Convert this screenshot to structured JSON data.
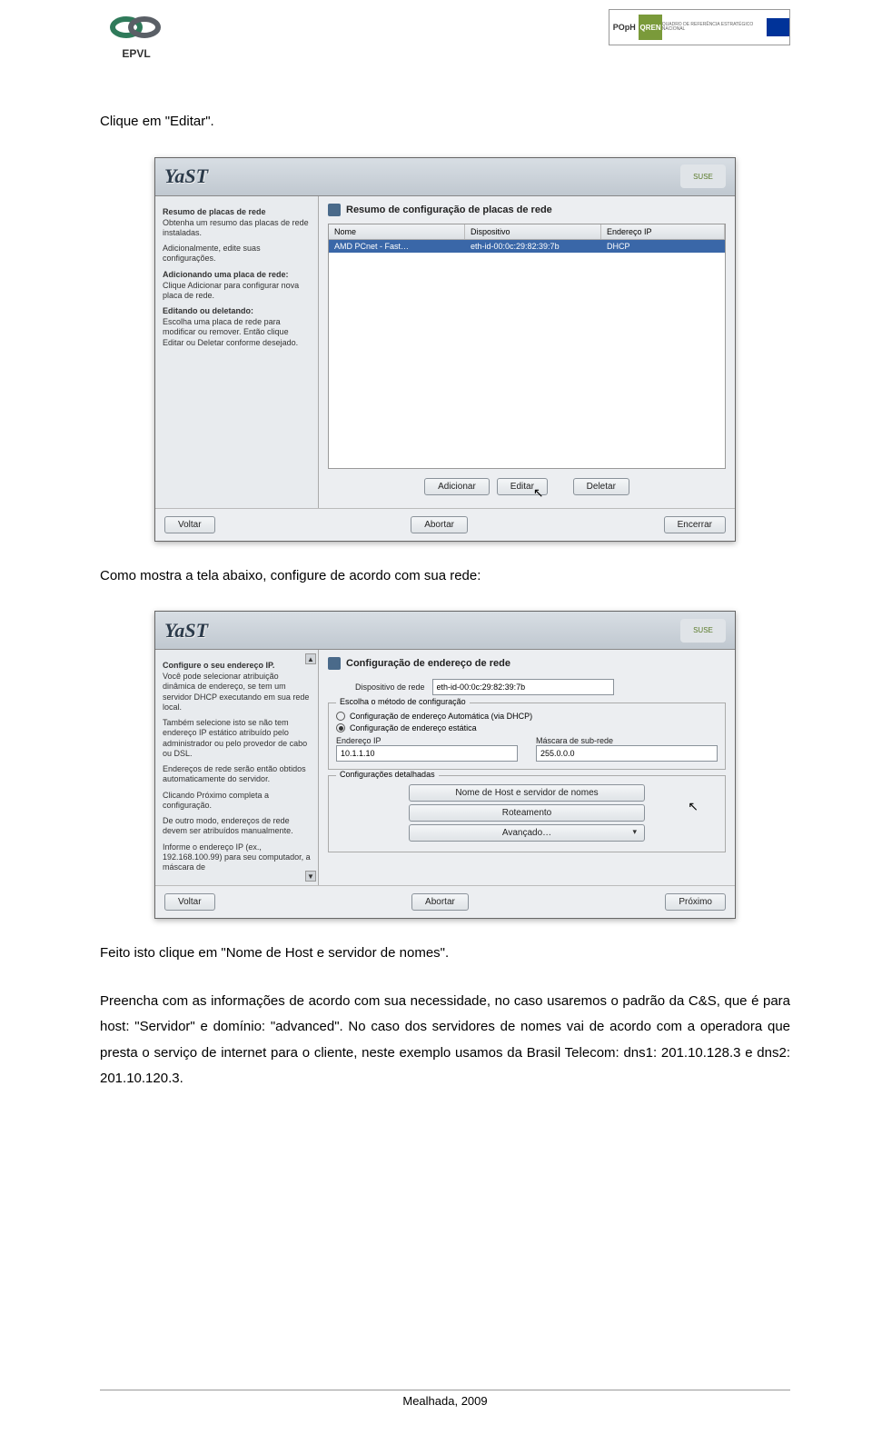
{
  "header": {
    "logo_left_text": "EPVL",
    "poph": "POpH",
    "qren": "QREN",
    "desc": "QUADRO DE REFERÊNCIA ESTRATÉGICO NACIONAL"
  },
  "text": {
    "p1": "Clique em \"Editar\".",
    "p2": "Como mostra a tela abaixo, configure de acordo com sua rede:",
    "p3": "Feito isto clique em \"Nome de Host e servidor de nomes\".",
    "p4": "Preencha com as informações de acordo com sua necessidade, no caso usaremos o padrão da C&S, que é para host: \"Servidor\" e domínio: \"advanced\". No caso dos servidores de nomes vai de acordo com a operadora que presta o serviço de internet para o cliente, neste exemplo usamos da Brasil Telecom: dns1: 201.10.128.3 e dns2: 201.10.120.3."
  },
  "yast": {
    "logo": "YaST",
    "suse": "SUSE"
  },
  "shot1": {
    "title": "Resumo de configuração de placas de rede",
    "side_h1": "Resumo de placas de rede",
    "side_p1": "Obtenha um resumo das placas de rede instaladas.",
    "side_p1b": "Adicionalmente, edite suas configurações.",
    "side_h2": "Adicionando uma placa de rede:",
    "side_p2": "Clique Adicionar para configurar nova placa de rede.",
    "side_h3": "Editando ou deletando:",
    "side_p3": "Escolha uma placa de rede para modificar ou remover. Então clique Editar ou Deletar conforme desejado.",
    "cols": {
      "nome": "Nome",
      "disp": "Dispositivo",
      "end": "Endereço IP"
    },
    "row": {
      "nome": "AMD PCnet - Fast…",
      "disp": "eth-id-00:0c:29:82:39:7b",
      "end": "DHCP"
    },
    "buttons": {
      "adicionar": "Adicionar",
      "editar": "Editar",
      "deletar": "Deletar",
      "voltar": "Voltar",
      "abortar": "Abortar",
      "encerrar": "Encerrar"
    }
  },
  "shot2": {
    "title": "Configuração de endereço de rede",
    "side_h1": "Configure o seu endereço IP.",
    "side_p1": "Você pode selecionar atribuição dinâmica de endereço, se tem um servidor DHCP executando em sua rede local.",
    "side_p2": "Também selecione isto se não tem endereço IP estático atribuído pelo administrador ou pelo provedor de cabo ou DSL.",
    "side_p3": "Endereços de rede serão então obtidos automaticamente do servidor.",
    "side_p4": "Clicando Próximo completa a configuração.",
    "side_p5": "De outro modo, endereços de rede devem ser atribuídos manualmente.",
    "side_p6": "Informe o endereço IP (ex., 192.168.100.99) para seu computador, a máscara de",
    "device_label": "Dispositivo de rede",
    "device_value": "eth-id-00:0c:29:82:39:7b",
    "method_legend": "Escolha o método de configuração",
    "radio_dhcp": "Configuração de endereço Automática (via DHCP)",
    "radio_static": "Configuração de endereço estática",
    "ip_label": "Endereço IP",
    "ip_value": "10.1.1.10",
    "mask_label": "Máscara de sub-rede",
    "mask_value": "255.0.0.0",
    "details_legend": "Configurações detalhadas",
    "btn_host": "Nome de Host e servidor de nomes",
    "btn_route": "Roteamento",
    "btn_adv": "Avançado…",
    "buttons": {
      "voltar": "Voltar",
      "abortar": "Abortar",
      "proximo": "Próximo"
    }
  },
  "footer": "Mealhada, 2009"
}
